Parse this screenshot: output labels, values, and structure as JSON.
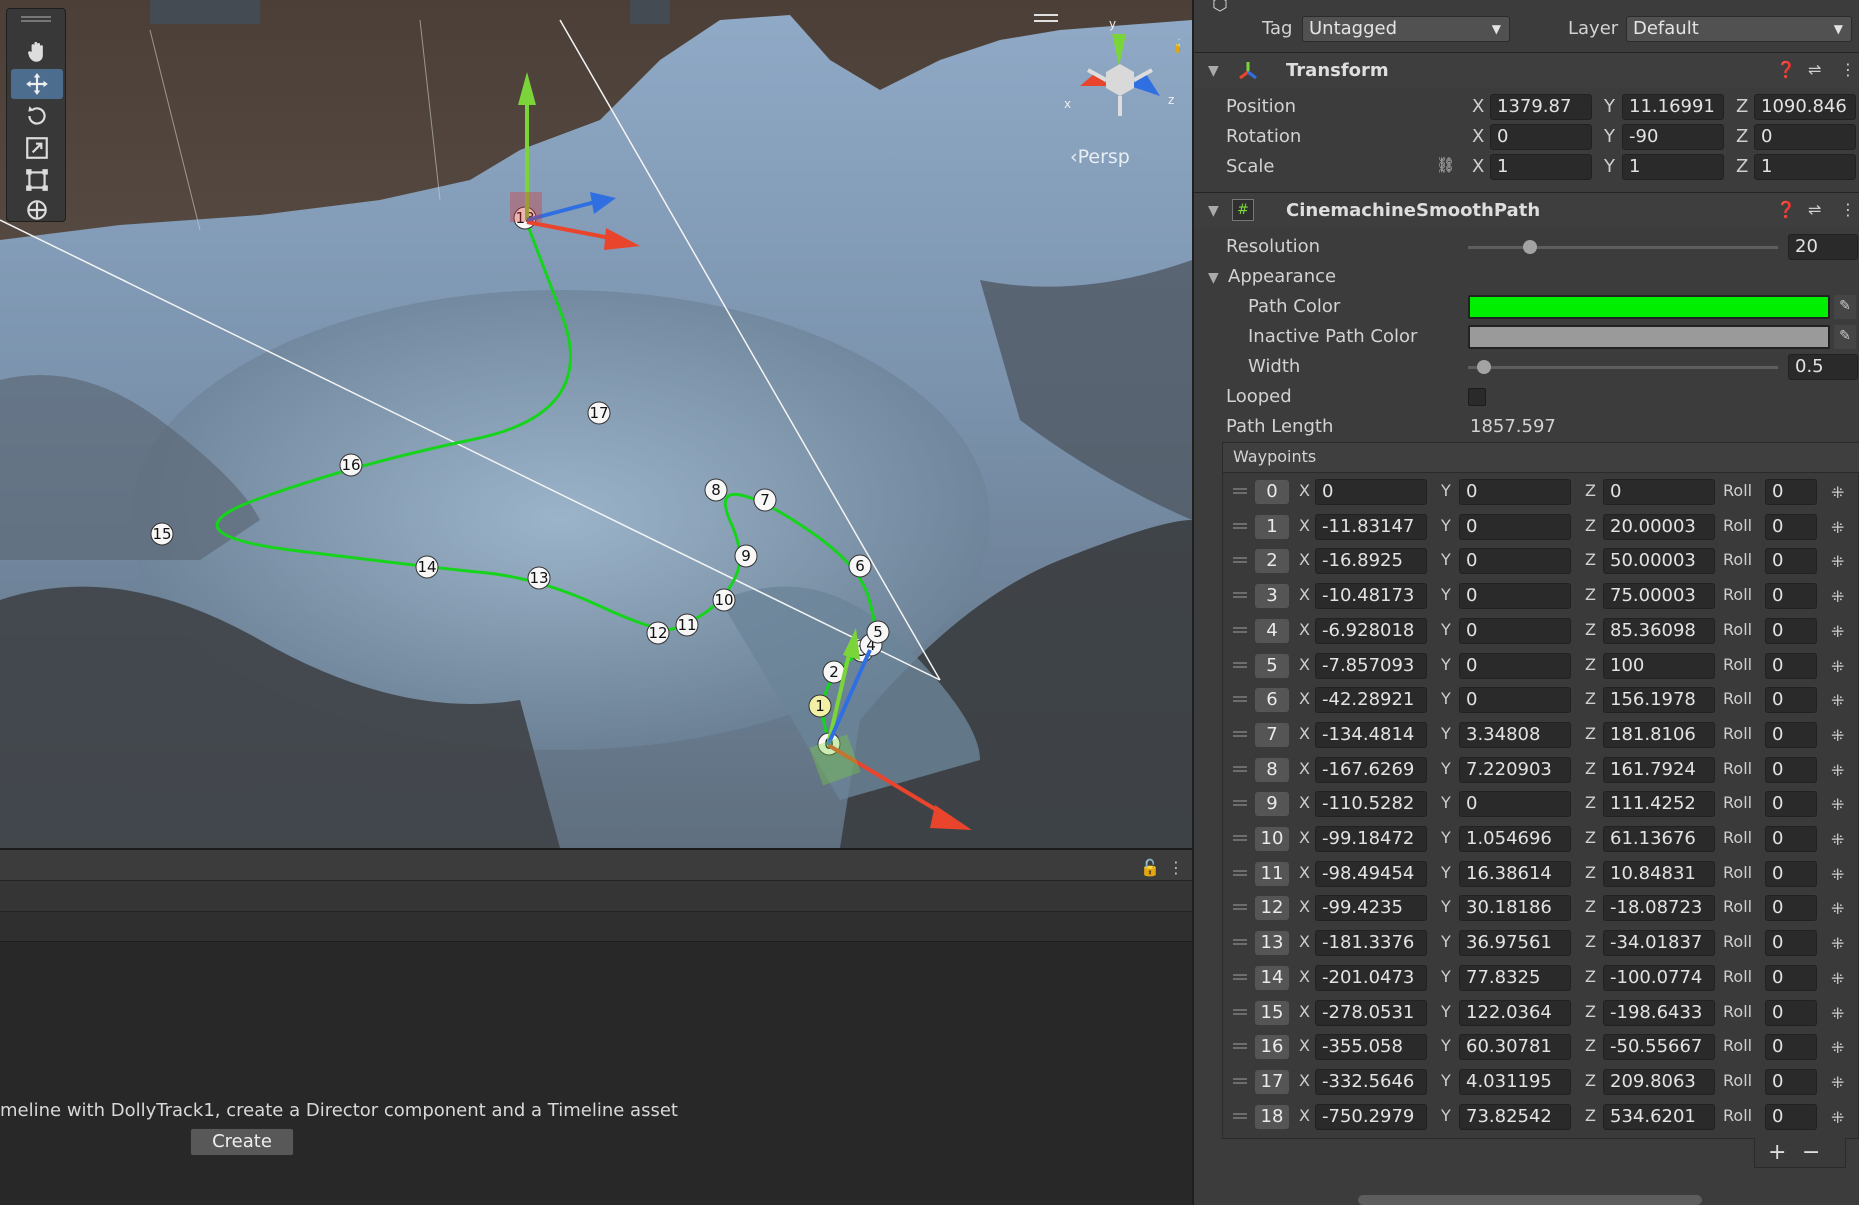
{
  "scene": {
    "persp_label": "Persp",
    "gizmo_axes": {
      "x": "x",
      "y": "y",
      "z": "z"
    },
    "axis_colors": {
      "x": "#e8452c",
      "y": "#7bd43a",
      "z": "#2f6fe2"
    },
    "path_color": "#16d41b",
    "waypoint_labels": [
      "0",
      "1",
      "2",
      "3",
      "4",
      "5",
      "6",
      "7",
      "8",
      "9",
      "10",
      "11",
      "12",
      "13",
      "14",
      "15",
      "16",
      "17",
      "18"
    ],
    "tools": [
      "hand-tool",
      "move-tool",
      "rotate-tool",
      "scale-tool",
      "rect-tool",
      "transform-tool"
    ]
  },
  "lower": {
    "message": "meline with DollyTrack1, create a Director component and a Timeline asset",
    "create_label": "Create"
  },
  "inspector": {
    "tag_label": "Tag",
    "tag_value": "Untagged",
    "layer_label": "Layer",
    "layer_value": "Default",
    "transform": {
      "title": "Transform",
      "position_label": "Position",
      "rotation_label": "Rotation",
      "scale_label": "Scale",
      "position": {
        "x": "1379.87",
        "y": "11.16991",
        "z": "1090.846"
      },
      "rotation": {
        "x": "0",
        "y": "-90",
        "z": "0"
      },
      "scale": {
        "x": "1",
        "y": "1",
        "z": "1"
      }
    },
    "path": {
      "title": "CinemachineSmoothPath",
      "resolution_label": "Resolution",
      "resolution_value": "20",
      "resolution_fraction": 0.2,
      "appearance_label": "Appearance",
      "path_color_label": "Path Color",
      "path_color": "#00ee00",
      "inactive_color_label": "Inactive Path Color",
      "inactive_color": "#9a9a9a",
      "width_label": "Width",
      "width_value": "0.5",
      "width_fraction": 0.05,
      "looped_label": "Looped",
      "looped": false,
      "path_length_label": "Path Length",
      "path_length_value": "1857.597",
      "waypoints_label": "Waypoints",
      "roll_label": "Roll",
      "waypoints": [
        {
          "index": "0",
          "x": "0",
          "y": "0",
          "z": "0",
          "roll": "0"
        },
        {
          "index": "1",
          "x": "-11.83147",
          "y": "0",
          "z": "20.00003",
          "roll": "0"
        },
        {
          "index": "2",
          "x": "-16.8925",
          "y": "0",
          "z": "50.00003",
          "roll": "0"
        },
        {
          "index": "3",
          "x": "-10.48173",
          "y": "0",
          "z": "75.00003",
          "roll": "0"
        },
        {
          "index": "4",
          "x": "-6.928018",
          "y": "0",
          "z": "85.36098",
          "roll": "0"
        },
        {
          "index": "5",
          "x": "-7.857093",
          "y": "0",
          "z": "100",
          "roll": "0"
        },
        {
          "index": "6",
          "x": "-42.28921",
          "y": "0",
          "z": "156.1978",
          "roll": "0"
        },
        {
          "index": "7",
          "x": "-134.4814",
          "y": "3.34808",
          "z": "181.8106",
          "roll": "0"
        },
        {
          "index": "8",
          "x": "-167.6269",
          "y": "7.220903",
          "z": "161.7924",
          "roll": "0"
        },
        {
          "index": "9",
          "x": "-110.5282",
          "y": "0",
          "z": "111.4252",
          "roll": "0"
        },
        {
          "index": "10",
          "x": "-99.18472",
          "y": "1.054696",
          "z": "61.13676",
          "roll": "0"
        },
        {
          "index": "11",
          "x": "-98.49454",
          "y": "16.38614",
          "z": "10.84831",
          "roll": "0"
        },
        {
          "index": "12",
          "x": "-99.4235",
          "y": "30.18186",
          "z": "-18.08723",
          "roll": "0"
        },
        {
          "index": "13",
          "x": "-181.3376",
          "y": "36.97561",
          "z": "-34.01837",
          "roll": "0"
        },
        {
          "index": "14",
          "x": "-201.0473",
          "y": "77.8325",
          "z": "-100.0774",
          "roll": "0"
        },
        {
          "index": "15",
          "x": "-278.0531",
          "y": "122.0364",
          "z": "-198.6433",
          "roll": "0"
        },
        {
          "index": "16",
          "x": "-355.058",
          "y": "60.30781",
          "z": "-50.55667",
          "roll": "0"
        },
        {
          "index": "17",
          "x": "-332.5646",
          "y": "4.031195",
          "z": "209.8063",
          "roll": "0"
        },
        {
          "index": "18",
          "x": "-750.2979",
          "y": "73.82542",
          "z": "534.6201",
          "roll": "0"
        }
      ],
      "add_label": "+",
      "remove_label": "−"
    }
  }
}
